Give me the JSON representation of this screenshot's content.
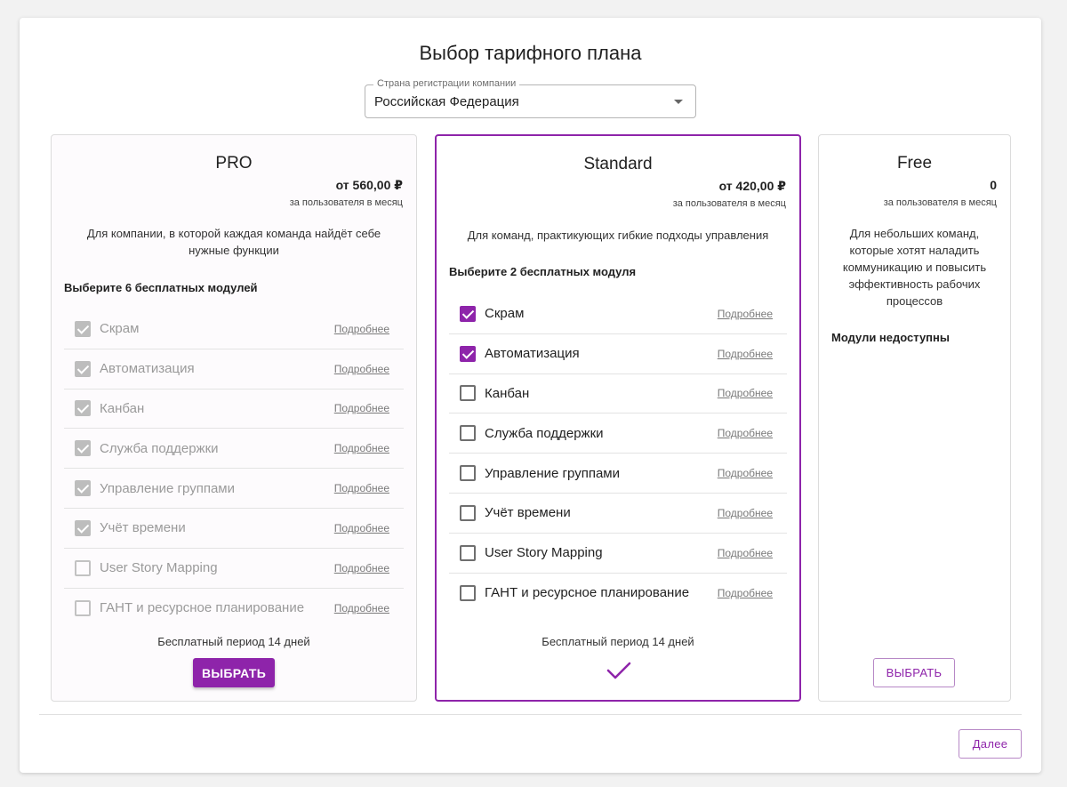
{
  "title": "Выбор тарифного плана",
  "country": {
    "label": "Страна регистрации компании",
    "value": "Российская Федерация"
  },
  "accent_color": "#8e24aa",
  "plans": {
    "pro": {
      "name": "PRO",
      "price": "от 560,00 ₽",
      "per": "за пользователя в месяц",
      "description": "Для компании, в которой каждая команда найдёт себе нужные функции",
      "pick_label": "Выберите 6 бесплатных модулей",
      "modules": [
        {
          "label": "Скрам",
          "link": "Подробнее",
          "checked": true
        },
        {
          "label": "Автоматизация",
          "link": "Подробнее",
          "checked": true
        },
        {
          "label": "Канбан",
          "link": "Подробнее",
          "checked": true
        },
        {
          "label": "Служба поддержки",
          "link": "Подробнее",
          "checked": true
        },
        {
          "label": "Управление группами",
          "link": "Подробнее",
          "checked": true
        },
        {
          "label": "Учёт времени",
          "link": "Подробнее",
          "checked": true
        },
        {
          "label": "User Story Mapping",
          "link": "Подробнее",
          "checked": false
        },
        {
          "label": "ГАНТ и ресурсное планирование",
          "link": "Подробнее",
          "checked": false
        }
      ],
      "trial": "Бесплатный период 14 дней",
      "button": "ВЫБРАТЬ"
    },
    "standard": {
      "name": "Standard",
      "price": "от 420,00 ₽",
      "per": "за пользователя в месяц",
      "description": "Для команд, практикующих гибкие подходы управления",
      "pick_label": "Выберите 2 бесплатных модуля",
      "modules": [
        {
          "label": "Скрам",
          "link": "Подробнее",
          "checked": true
        },
        {
          "label": "Автоматизация",
          "link": "Подробнее",
          "checked": true
        },
        {
          "label": "Канбан",
          "link": "Подробнее",
          "checked": false
        },
        {
          "label": "Служба поддержки",
          "link": "Подробнее",
          "checked": false
        },
        {
          "label": "Управление группами",
          "link": "Подробнее",
          "checked": false
        },
        {
          "label": "Учёт времени",
          "link": "Подробнее",
          "checked": false
        },
        {
          "label": "User Story Mapping",
          "link": "Подробнее",
          "checked": false
        },
        {
          "label": "ГАНТ и ресурсное планирование",
          "link": "Подробнее",
          "checked": false
        }
      ],
      "trial": "Бесплатный период 14 дней"
    },
    "free": {
      "name": "Free",
      "price": "0",
      "per": "за пользователя в месяц",
      "description": "Для небольших команд, которые хотят наладить коммуникацию и повысить эффективность рабочих процессов",
      "modules_note": "Модули недоступны",
      "button": "ВЫБРАТЬ"
    }
  },
  "footer": {
    "next": "Далее"
  }
}
